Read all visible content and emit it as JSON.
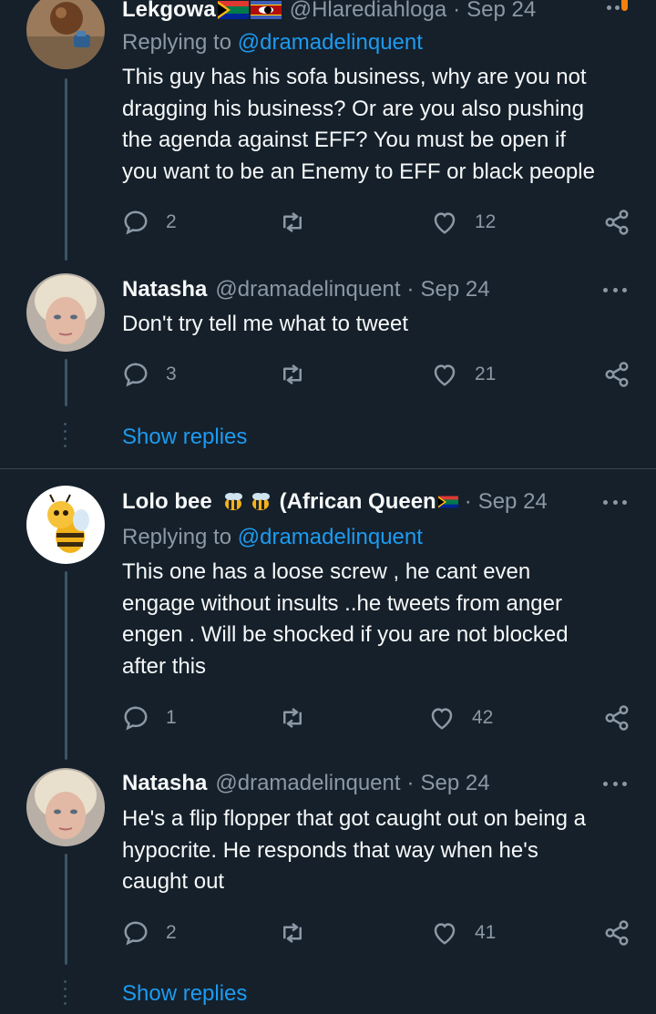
{
  "tweets": [
    {
      "name": "Lekgowa",
      "handle": "@Hlarediahloga",
      "date": "Sep 24",
      "replying_prefix": "Replying to",
      "replying_to": "@dramadelinquent",
      "lines": [
        "This guy has his sofa business, why are you not",
        "dragging his business? Or are you also pushing",
        "the agenda against EFF? You must be open if",
        "you want to be an Enemy to EFF or black people"
      ],
      "replies": "2",
      "retweets": "",
      "likes": "12"
    },
    {
      "name": "Natasha",
      "handle": "@dramadelinquent",
      "date": "Sep 24",
      "lines": [
        "Don't try tell me what to tweet"
      ],
      "replies": "3",
      "retweets": "",
      "likes": "21"
    },
    {
      "name": "Lolo bee",
      "name_suffix": "(African Queen",
      "handle": "",
      "date": "Sep 24",
      "replying_prefix": "Replying to",
      "replying_to": "@dramadelinquent",
      "lines": [
        "This one has a loose screw , he cant even",
        "engage without insults ..he tweets from anger",
        "engen . Will be shocked if you are not blocked",
        "after this"
      ],
      "replies": "1",
      "retweets": "",
      "likes": "42"
    },
    {
      "name": "Natasha",
      "handle": "@dramadelinquent",
      "date": "Sep 24",
      "lines": [
        "He's a flip flopper that got caught out on being a",
        "hypocrite. He responds that way when he's",
        "caught out"
      ],
      "replies": "2",
      "retweets": "",
      "likes": "41"
    }
  ],
  "show_replies_label": "Show replies",
  "colors": {
    "background": "#15202b",
    "text": "#f7f9f9",
    "muted": "#8b98a5",
    "link": "#1d9bf0",
    "divider": "#38444d"
  },
  "icons": [
    "reply-icon",
    "retweet-icon",
    "like-icon",
    "share-icon",
    "more-icon"
  ]
}
